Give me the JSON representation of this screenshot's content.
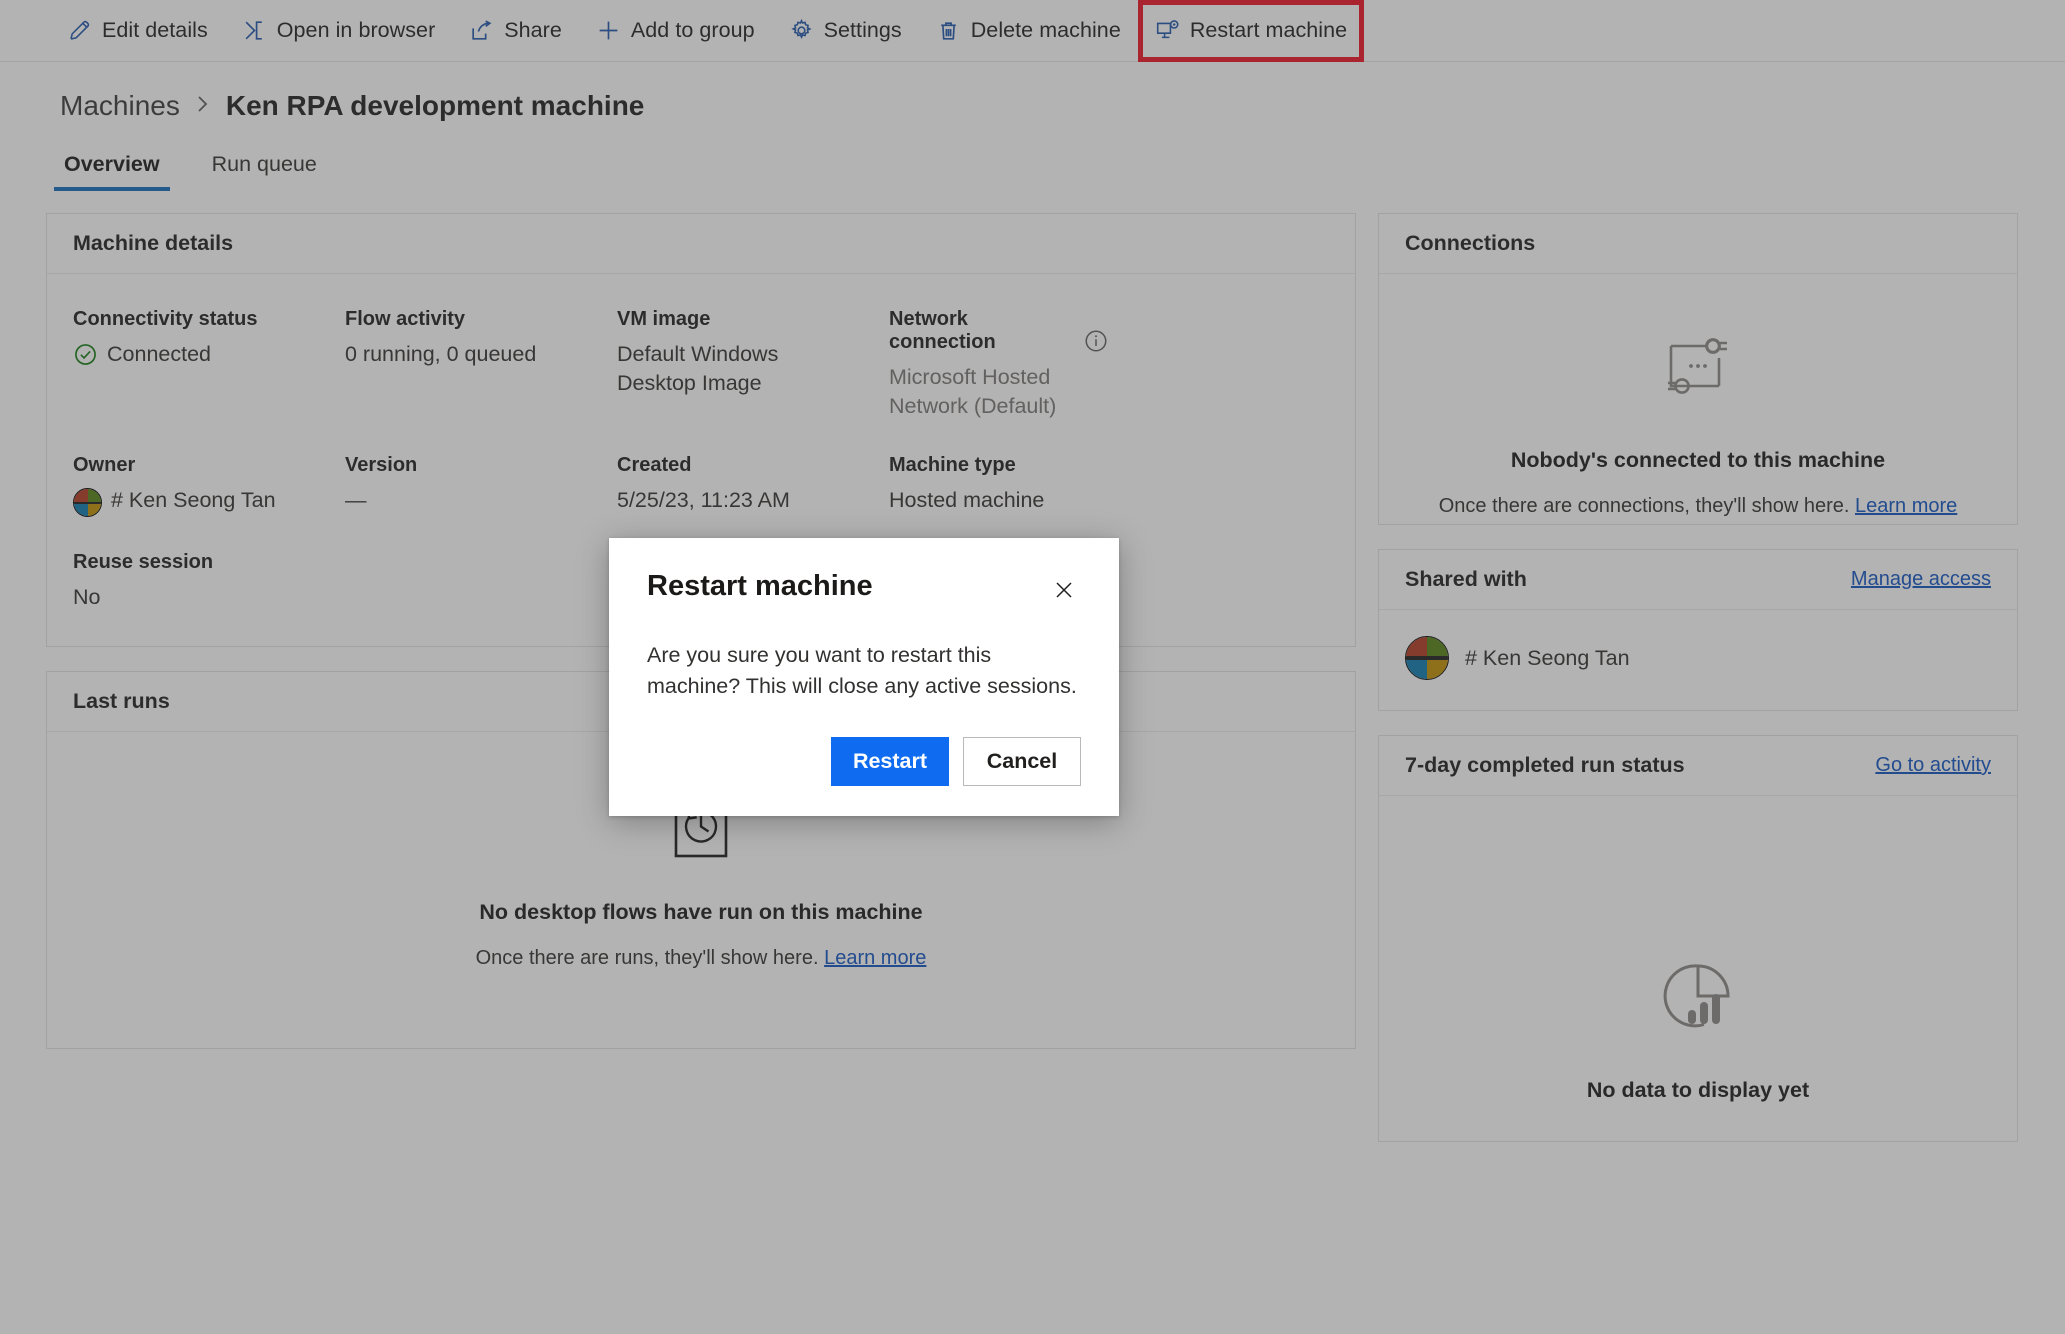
{
  "toolbar": {
    "items": [
      {
        "label": "Edit details",
        "icon": "pencil-icon"
      },
      {
        "label": "Open in browser",
        "icon": "open-in-browser-icon"
      },
      {
        "label": "Share",
        "icon": "share-icon"
      },
      {
        "label": "Add to group",
        "icon": "plus-icon"
      },
      {
        "label": "Settings",
        "icon": "gear-icon"
      },
      {
        "label": "Delete machine",
        "icon": "trash-icon"
      },
      {
        "label": "Restart machine",
        "icon": "restart-machine-icon"
      }
    ],
    "highlighted_item": "Restart machine",
    "highlight_color": "#ee1122",
    "icon_color": "#1f56ac"
  },
  "breadcrumb": {
    "root": "Machines",
    "separator": "›",
    "current": "Ken RPA development machine"
  },
  "tabs": [
    {
      "label": "Overview",
      "active": true
    },
    {
      "label": "Run queue",
      "active": false
    }
  ],
  "accent_color": "#0f6cbd",
  "machine_details": {
    "title": "Machine details",
    "fields": {
      "connectivity_status_label": "Connectivity status",
      "connectivity_status_value": "Connected",
      "connectivity_status_color": "#107c10",
      "flow_activity_label": "Flow activity",
      "flow_activity_value": "0 running, 0 queued",
      "vm_image_label": "VM image",
      "vm_image_value": "Default Windows Desktop Image",
      "network_connection_label": "Network connection",
      "network_connection_value": "Microsoft Hosted Network (Default)",
      "owner_label": "Owner",
      "owner_value": "# Ken Seong Tan",
      "version_label": "Version",
      "version_value": "—",
      "created_label": "Created",
      "created_value": "5/25/23, 11:23 AM",
      "machine_type_label": "Machine type",
      "machine_type_value": "Hosted machine",
      "reuse_session_label": "Reuse session",
      "reuse_session_value": "No"
    }
  },
  "last_runs": {
    "title": "Last runs",
    "empty_title": "No desktop flows have run on this machine",
    "empty_sub_text": "Once there are runs, they'll show here.",
    "empty_sub_link": "Learn more",
    "icon": "history-icon"
  },
  "connections": {
    "title": "Connections",
    "empty_title": "Nobody's connected to this machine",
    "empty_sub_text": "Once there are connections, they'll show here.",
    "empty_sub_link": "Learn more",
    "icon": "plug-connection-icon"
  },
  "shared_with": {
    "title": "Shared with",
    "action_link": "Manage access",
    "people": [
      {
        "name": "# Ken Seong Tan"
      }
    ]
  },
  "run_status": {
    "title": "7-day completed run status",
    "action_link": "Go to activity",
    "empty_title": "No data to display yet",
    "icon": "pie-bar-chart-icon"
  },
  "dialog": {
    "title": "Restart machine",
    "message": "Are you sure you want to restart this machine? This will close any active sessions.",
    "primary_button": "Restart",
    "secondary_button": "Cancel",
    "close_icon": "close-icon",
    "primary_color": "#0f6cf0"
  }
}
